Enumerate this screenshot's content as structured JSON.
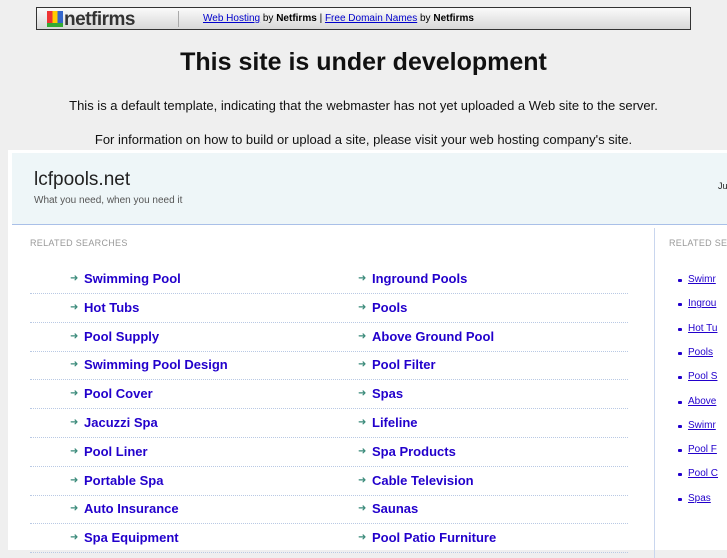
{
  "topbar": {
    "logo": "netfirms",
    "link1": "Web Hosting",
    "by1": "by",
    "brand1": "Netfirms",
    "pipe": "|",
    "link2": "Free Domain Names",
    "by2": "by",
    "brand2": "Netfirms"
  },
  "title": "This site is under development",
  "line1": "This is a default template, indicating that the webmaster has not yet uploaded a Web site to the server.",
  "line2": "For information on how to build or upload a site, please visit your web hosting company's site.",
  "site": {
    "name": "lcfpools.net",
    "tagline": "What you need, when you need it",
    "right_text": "Ju"
  },
  "related_label": "RELATED SEARCHES",
  "side_label": "RELATED SE",
  "left": [
    "Swimming Pool",
    "Hot Tubs",
    "Pool Supply",
    "Swimming Pool Design",
    "Pool Cover",
    "Jacuzzi Spa",
    "Pool Liner",
    "Portable Spa",
    "Auto Insurance",
    "Spa Equipment"
  ],
  "right": [
    "Inground Pools",
    "Pools",
    "Above Ground Pool",
    "Pool Filter",
    "Spas",
    "Lifeline",
    "Spa Products",
    "Cable Television",
    "Saunas",
    "Pool Patio Furniture"
  ],
  "side": [
    "Swimr",
    "Ingrou",
    "Hot Tu",
    "Pools",
    "Pool S",
    "Above",
    "Swimr",
    "Pool F",
    "Pool C",
    "Spas"
  ]
}
